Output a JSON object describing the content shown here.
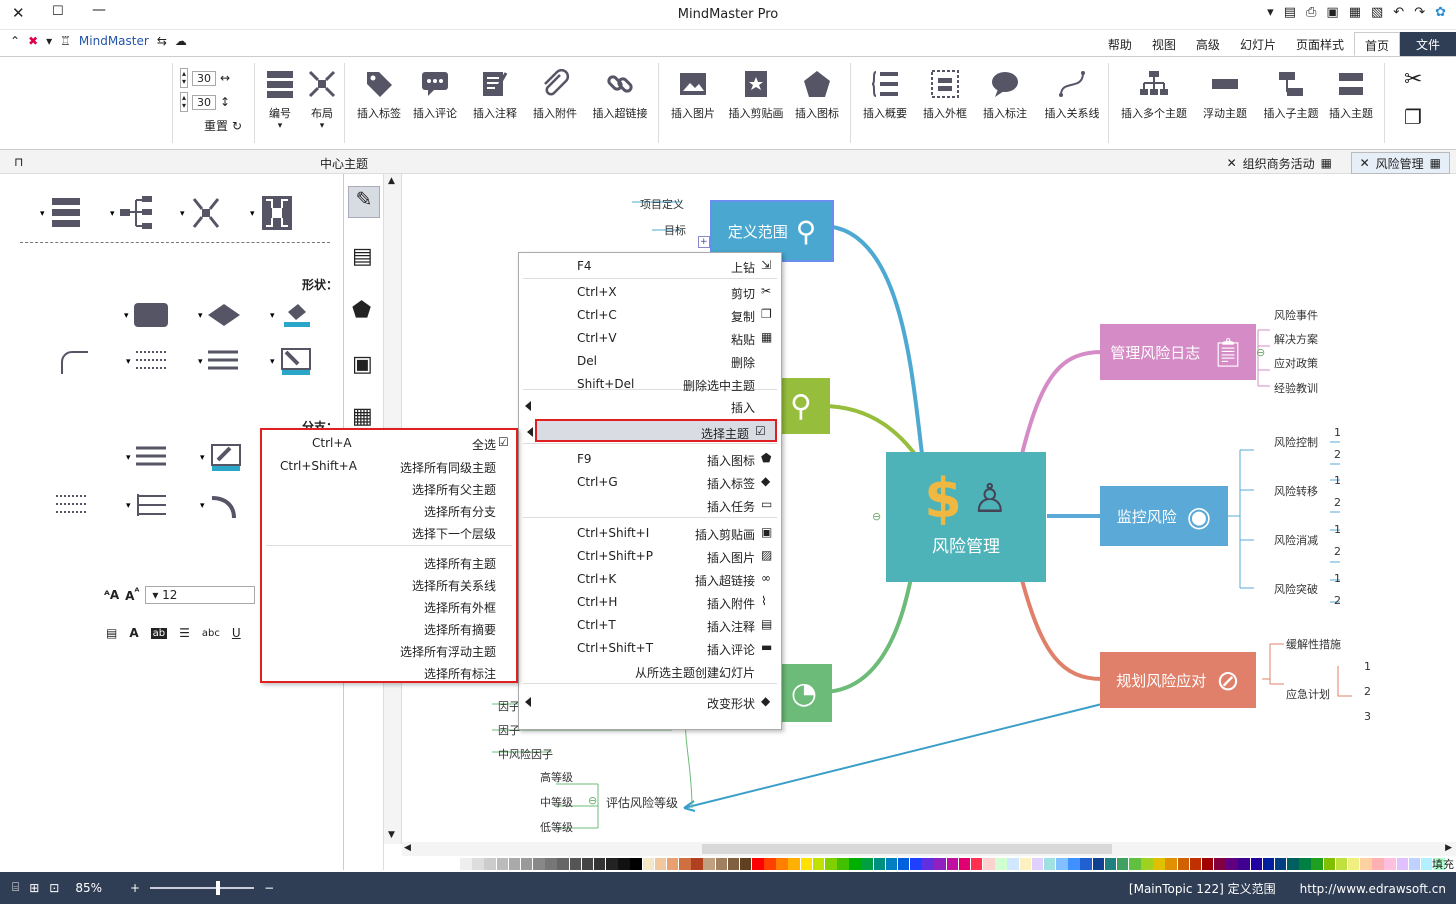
{
  "window": {
    "title": "MindMaster Pro",
    "brand": "MindMaster"
  },
  "ribbon_tabs": [
    "文件",
    "首页",
    "页面样式",
    "幻灯片",
    "高级",
    "视图",
    "帮助"
  ],
  "ribbon_buttons": [
    {
      "label": "插入主题"
    },
    {
      "label": "插入子主题"
    },
    {
      "label": "浮动主题"
    },
    {
      "label": "插入多个主题"
    },
    {
      "label": "插入关系线"
    },
    {
      "label": "插入标注"
    },
    {
      "label": "插入外框"
    },
    {
      "label": "插入概要"
    },
    {
      "label": "插入图标"
    },
    {
      "label": "插入剪贴画"
    },
    {
      "label": "插入图片"
    },
    {
      "label": "插入超链接"
    },
    {
      "label": "插入附件"
    },
    {
      "label": "插入注释"
    },
    {
      "label": "插入评论"
    },
    {
      "label": "插入标签"
    },
    {
      "label": "布局"
    },
    {
      "label": "编号"
    }
  ],
  "spacing": {
    "h_value": "30",
    "v_value": "30",
    "reset_label": "重置"
  },
  "doc_tabs": [
    {
      "label": "风险管理",
      "active": true
    },
    {
      "label": "组织商务活动",
      "active": false
    }
  ],
  "panel_title": "中心主题",
  "left_panel": {
    "shape_label": "形状：",
    "branch_label": "分支：",
    "font_size": "12"
  },
  "context_menu": {
    "items": [
      {
        "label": "上钻",
        "shortcut": "F4"
      },
      {
        "label": "剪切",
        "shortcut": "Ctrl+X"
      },
      {
        "label": "复制",
        "shortcut": "Ctrl+C"
      },
      {
        "label": "粘贴",
        "shortcut": "Ctrl+V"
      },
      {
        "label": "删除",
        "shortcut": "Del"
      },
      {
        "label": "删除选中主题",
        "shortcut": "Shift+Del"
      },
      {
        "label": "插入",
        "shortcut": ""
      },
      {
        "label": "选择主题",
        "shortcut": ""
      },
      {
        "label": "插入图标",
        "shortcut": "F9"
      },
      {
        "label": "插入标签",
        "shortcut": "Ctrl+G"
      },
      {
        "label": "插入任务",
        "shortcut": ""
      },
      {
        "label": "插入剪贴画",
        "shortcut": "Ctrl+Shift+I"
      },
      {
        "label": "插入图片",
        "shortcut": "Ctrl+Shift+P"
      },
      {
        "label": "插入超链接",
        "shortcut": "Ctrl+K"
      },
      {
        "label": "插入附件",
        "shortcut": "Ctrl+H"
      },
      {
        "label": "插入注释",
        "shortcut": "Ctrl+T"
      },
      {
        "label": "插入评论",
        "shortcut": "Ctrl+Shift+T"
      },
      {
        "label": "从所选主题创建幻灯片",
        "shortcut": ""
      },
      {
        "label": "改变形状",
        "shortcut": ""
      }
    ]
  },
  "submenu": {
    "items": [
      {
        "label": "全选",
        "shortcut": "Ctrl+A"
      },
      {
        "label": "选择所有同级主题",
        "shortcut": "Ctrl+Shift+A"
      },
      {
        "label": "选择所有父主题",
        "shortcut": ""
      },
      {
        "label": "选择所有分支",
        "shortcut": ""
      },
      {
        "label": "选择下一个层级",
        "shortcut": ""
      },
      {
        "label": "选择所有主题",
        "shortcut": ""
      },
      {
        "label": "选择所有关系线",
        "shortcut": ""
      },
      {
        "label": "选择所有外框",
        "shortcut": ""
      },
      {
        "label": "选择所有摘要",
        "shortcut": ""
      },
      {
        "label": "选择所有浮动主题",
        "shortcut": ""
      },
      {
        "label": "选择所有标注",
        "shortcut": ""
      }
    ]
  },
  "mindmap": {
    "center": "风险管理",
    "topics": {
      "define_scope": "定义范围",
      "log": "管理风险日志",
      "monitor": "监控风险",
      "plan": "规划风险应对"
    },
    "define_scope_children": [
      "项目定义",
      "目标"
    ],
    "log_children": [
      "风险事件",
      "解决方案",
      "应对政策",
      "经验教训"
    ],
    "monitor_children": [
      "风险控制",
      "风险转移",
      "风险消减",
      "风险突破"
    ],
    "plan_children": [
      "缓解性措施",
      "应急计划"
    ],
    "numbers": [
      "1",
      "2",
      "3"
    ],
    "eval_topic": "评估风险等级",
    "eval_children": [
      "高等级",
      "中等级",
      "低等级"
    ],
    "mid_factor": "中风险因子",
    "factor_partial": "因子"
  },
  "palette_label": "填充",
  "status": {
    "url": "http://www.edrawsoft.cn",
    "info": "[MainTopic 122]  定义范围",
    "zoom": "85%"
  },
  "colors": {
    "accent_dark": "#2f3d55",
    "teal": "#4db3b8",
    "blue": "#5aa9d6",
    "pink": "#d58bc6",
    "green": "#96be3c",
    "salmon": "#e0806a",
    "highlight": "#e02020"
  }
}
